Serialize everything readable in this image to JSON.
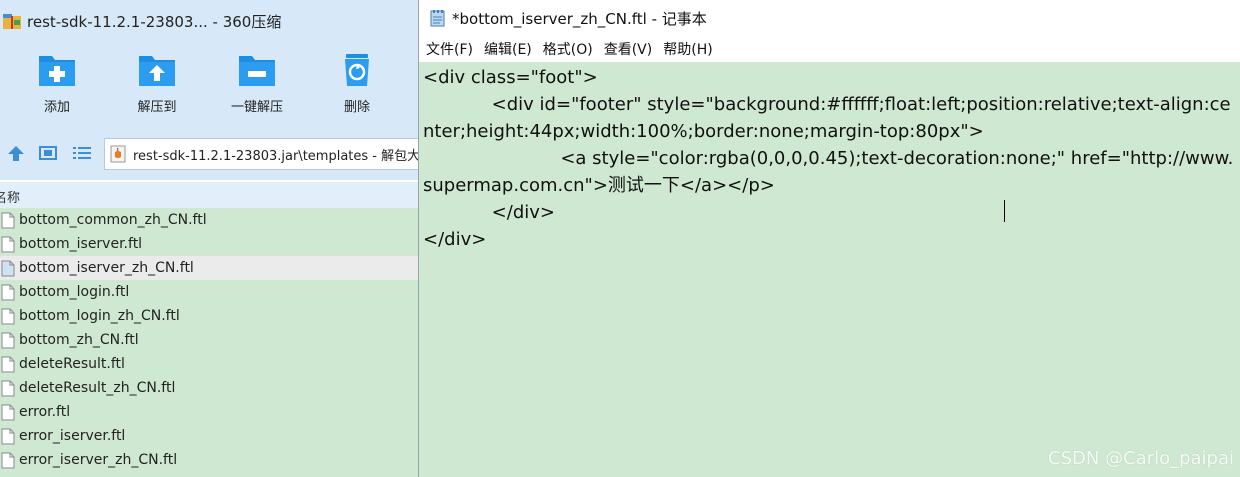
{
  "archive_window": {
    "title": "rest-sdk-11.2.1-23803... - 360压缩",
    "toolbar": [
      {
        "label": "添加",
        "icon": "add-icon"
      },
      {
        "label": "解压到",
        "icon": "extract-to-icon"
      },
      {
        "label": "一键解压",
        "icon": "one-click-extract-icon"
      },
      {
        "label": "删除",
        "icon": "delete-icon"
      }
    ],
    "address": "rest-sdk-11.2.1-23803.jar\\templates - 解包大",
    "column_name": "名称",
    "files": [
      "bottom_common_zh_CN.ftl",
      "bottom_iserver.ftl",
      "bottom_iserver_zh_CN.ftl",
      "bottom_login.ftl",
      "bottom_login_zh_CN.ftl",
      "bottom_zh_CN.ftl",
      "deleteResult.ftl",
      "deleteResult_zh_CN.ftl",
      "error.ftl",
      "error_iserver.ftl",
      "error_iserver_zh_CN.ftl"
    ],
    "selected_file": "bottom_iserver_zh_CN.ftl"
  },
  "notepad_window": {
    "title": "*bottom_iserver_zh_CN.ftl - 记事本",
    "menu": [
      "文件(F)",
      "编辑(E)",
      "格式(O)",
      "查看(V)",
      "帮助(H)"
    ],
    "content": "<div class=\"foot\">\n\t\t<div id=\"footer\" style=\"background:#ffffff;float:left;position:relative;text-align:center;height:44px;width:100%;border:none;margin-top:80px\">\n\t\t\t\t<a style=\"color:rgba(0,0,0,0.45);text-decoration:none;\" href=\"http://www.supermap.com.cn\">测试一下</a></p>\n\t\t</div>\n</div>"
  },
  "watermark": "CSDN @Carlo_paipai",
  "colors": {
    "toolbar_bg": "#d7e9f9",
    "editor_bg": "#cfe8d1",
    "icon_blue": "#1e8fe0"
  }
}
